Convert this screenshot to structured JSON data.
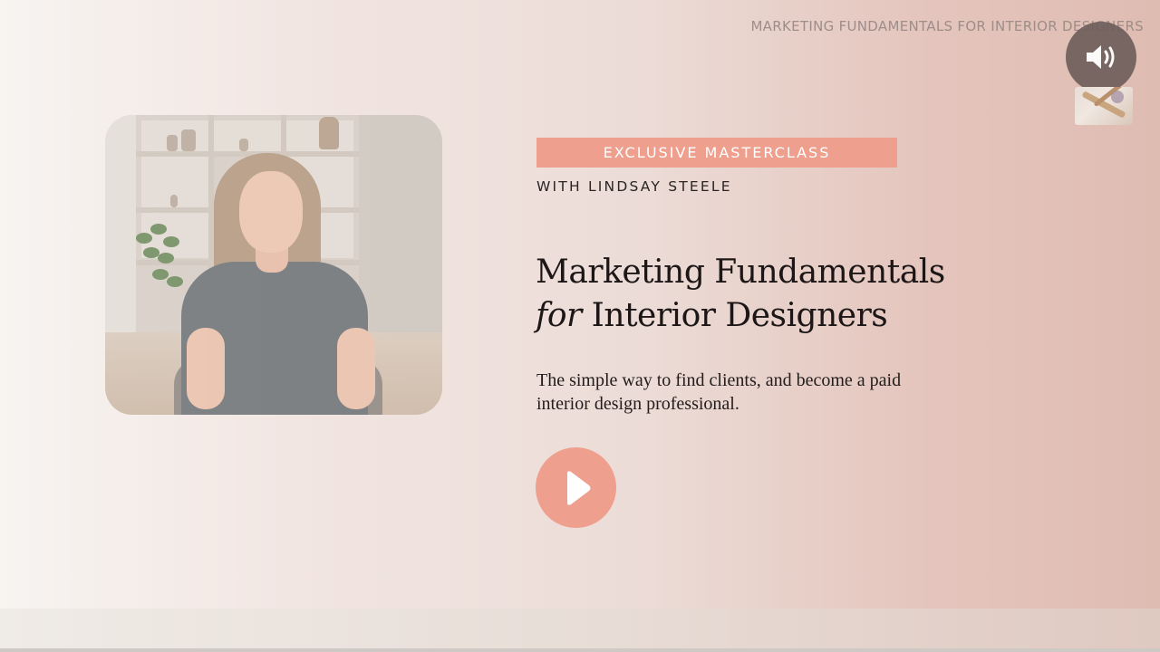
{
  "header": {
    "course_title": "MARKETING FUNDAMENTALS FOR INTERIOR DESIGNERS",
    "sound_icon": "speaker-volume-icon"
  },
  "hero": {
    "badge_label": "EXCLUSIVE MASTERCLASS",
    "presenter": "WITH LINDSAY STEELE",
    "heading_line1": "Marketing Fundamentals",
    "heading_line2_italic": "for",
    "heading_line2_rest": " Interior Designers",
    "subtitle": "The simple way to find clients, and become a paid interior design professional.",
    "play_icon": "play-icon"
  },
  "colors": {
    "accent": "#ee9f8d",
    "heading_text": "#1c1716",
    "sound_button": "#6f5f5b"
  }
}
